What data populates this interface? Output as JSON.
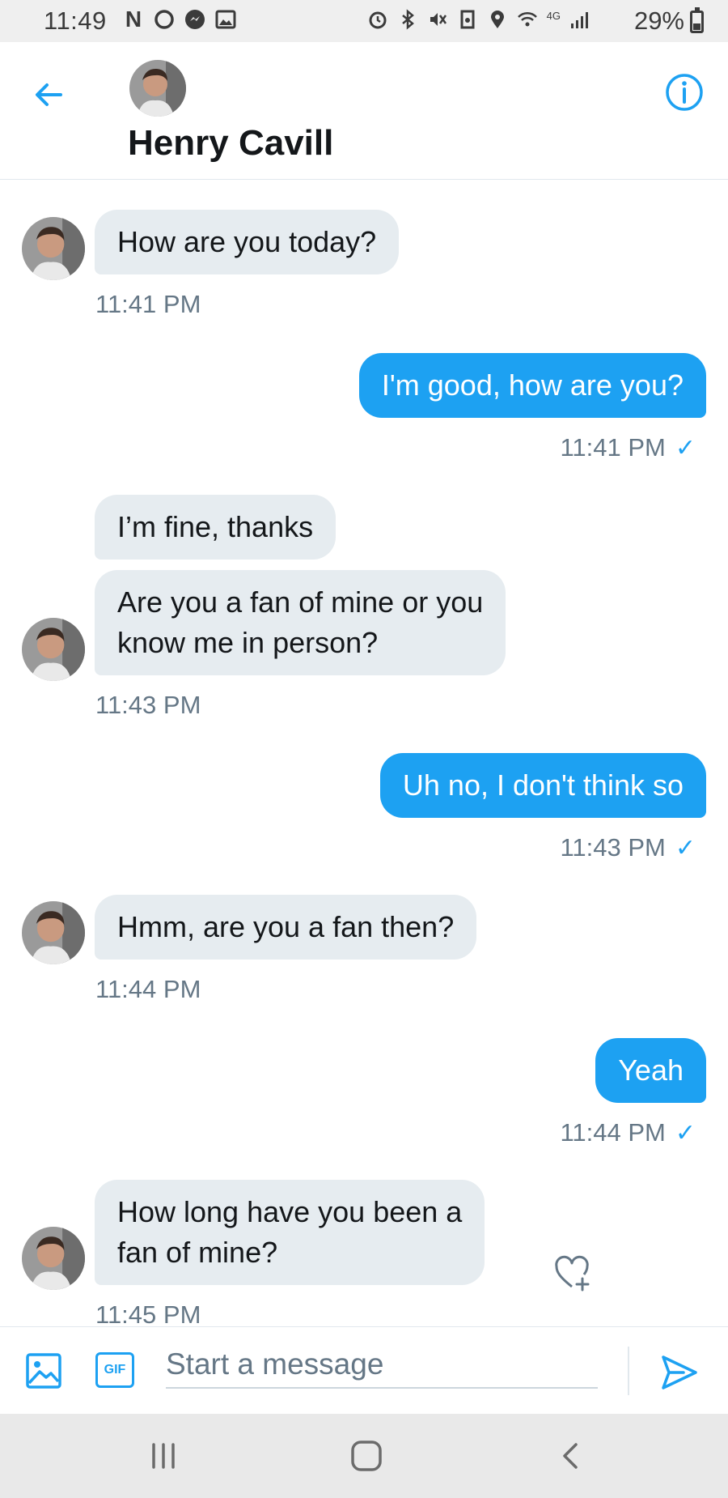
{
  "status_bar": {
    "time": "11:49",
    "battery_percent": "29%",
    "network": "4G",
    "left_icons": [
      "netflix-icon",
      "circle-icon",
      "messenger-icon",
      "gallery-icon"
    ],
    "right_icons": [
      "alarm-icon",
      "bluetooth-icon",
      "mute-icon",
      "save-icon",
      "location-icon",
      "wifi-icon",
      "signal-icon"
    ]
  },
  "header": {
    "title": "Henry Cavill",
    "back_icon": "back-arrow-icon",
    "info_icon": "info-icon"
  },
  "messages": [
    {
      "direction": "in",
      "lines": [
        "How are you today?"
      ],
      "time": "11:41 PM"
    },
    {
      "direction": "out",
      "lines": [
        "I'm good, how are you?"
      ],
      "time": "11:41 PM"
    },
    {
      "direction": "in",
      "lines": [
        "I’m fine, thanks"
      ],
      "time": ""
    },
    {
      "direction": "in",
      "lines": [
        "Are you a fan of mine or you",
        "know me in person?"
      ],
      "time": "11:43 PM"
    },
    {
      "direction": "out",
      "lines": [
        "Uh no, I don't think so"
      ],
      "time": "11:43 PM"
    },
    {
      "direction": "in",
      "lines": [
        "Hmm, are you a fan then?"
      ],
      "time": "11:44 PM"
    },
    {
      "direction": "out",
      "lines": [
        "Yeah"
      ],
      "time": "11:44 PM"
    },
    {
      "direction": "in",
      "lines": [
        "How long have you been a",
        "fan of mine?"
      ],
      "time": "11:45 PM"
    }
  ],
  "composer": {
    "placeholder": "Start a message",
    "gif_label": "GIF"
  },
  "colors": {
    "accent": "#1da1f2",
    "incoming_bubble": "#e6ecf0",
    "timestamp": "#657786"
  }
}
